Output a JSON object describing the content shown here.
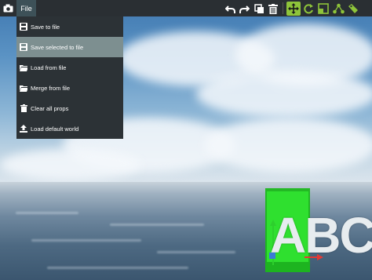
{
  "toolbar": {
    "file_label": "File",
    "icons": [
      "camera-icon",
      "undo-icon",
      "redo-icon",
      "copy-icon",
      "delete-icon",
      "move-icon",
      "rotate-icon",
      "scale-icon",
      "group-icon",
      "tag-icon"
    ],
    "active_tool": "move",
    "accent_color": "#8ec43a"
  },
  "file_menu": {
    "items": [
      {
        "label": "Save to file",
        "icon": "save-icon"
      },
      {
        "label": "Save selected to file",
        "icon": "save-icon",
        "highlighted": true
      },
      {
        "label": "Load from file",
        "icon": "folder-open-icon"
      },
      {
        "label": "Merge from file",
        "icon": "folder-open-icon"
      },
      {
        "label": "Clear all props",
        "icon": "trash-icon"
      },
      {
        "label": "Load default world",
        "icon": "upload-icon"
      }
    ]
  },
  "scene": {
    "prop_text": "ABC",
    "selection_color": "#2fe02f"
  }
}
